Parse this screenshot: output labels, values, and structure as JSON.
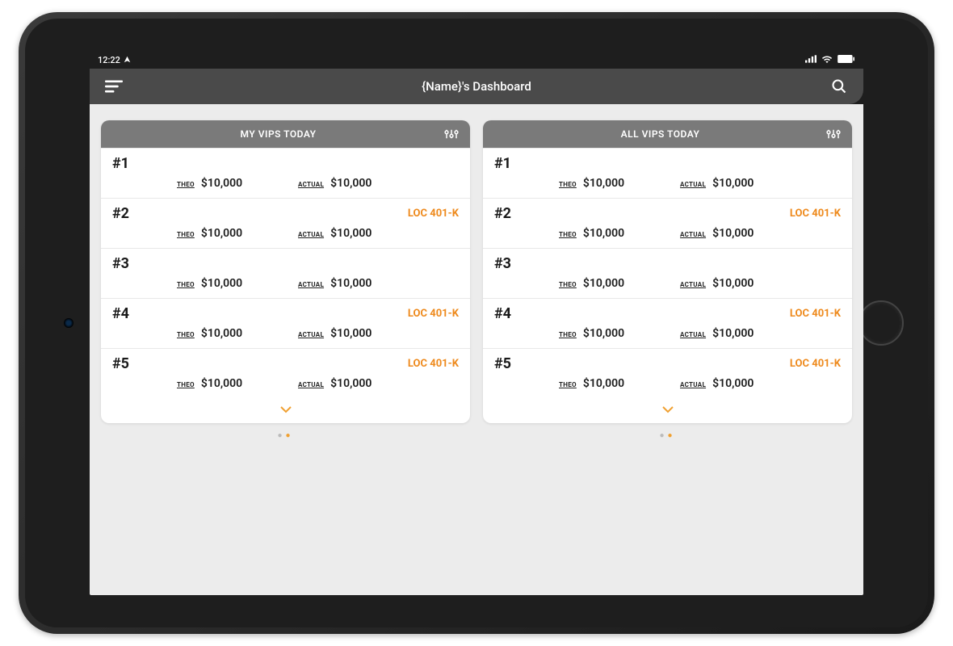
{
  "status_bar": {
    "time": "12:22"
  },
  "header": {
    "title": "{Name}'s Dashboard"
  },
  "labels": {
    "theo": "THEO",
    "actual": "ACTUAL"
  },
  "colors": {
    "accent": "#ee8a1d",
    "header_bg": "#4a4a4a",
    "panel_header_bg": "#7a7a7a"
  },
  "panels": [
    {
      "title": "MY VIPS TODAY",
      "rows": [
        {
          "rank": "#1",
          "theo": "$10,000",
          "actual": "$10,000",
          "loc": ""
        },
        {
          "rank": "#2",
          "theo": "$10,000",
          "actual": "$10,000",
          "loc": "LOC 401-K"
        },
        {
          "rank": "#3",
          "theo": "$10,000",
          "actual": "$10,000",
          "loc": ""
        },
        {
          "rank": "#4",
          "theo": "$10,000",
          "actual": "$10,000",
          "loc": "LOC 401-K"
        },
        {
          "rank": "#5",
          "theo": "$10,000",
          "actual": "$10,000",
          "loc": "LOC 401-K"
        }
      ]
    },
    {
      "title": "ALL VIPS TODAY",
      "rows": [
        {
          "rank": "#1",
          "theo": "$10,000",
          "actual": "$10,000",
          "loc": ""
        },
        {
          "rank": "#2",
          "theo": "$10,000",
          "actual": "$10,000",
          "loc": "LOC 401-K"
        },
        {
          "rank": "#3",
          "theo": "$10,000",
          "actual": "$10,000",
          "loc": ""
        },
        {
          "rank": "#4",
          "theo": "$10,000",
          "actual": "$10,000",
          "loc": "LOC 401-K"
        },
        {
          "rank": "#5",
          "theo": "$10,000",
          "actual": "$10,000",
          "loc": "LOC 401-K"
        }
      ]
    }
  ]
}
